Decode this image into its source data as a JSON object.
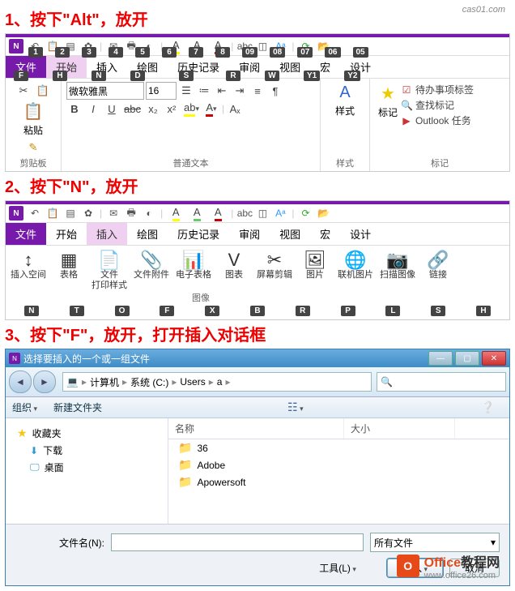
{
  "watermark": "cas01.com",
  "steps": {
    "s1": "1、按下\"Alt\"，放开",
    "s2": "2、按下\"N\"，放开",
    "s3": "3、按下\"F\"，放开，打开插入对话框"
  },
  "qat_keys": [
    "1",
    "2",
    "3",
    "4",
    "5",
    "6",
    "7",
    "8",
    "09",
    "08",
    "07",
    "06",
    "05"
  ],
  "tabs1": {
    "file": "文件",
    "home": "开始",
    "insert": "插入",
    "draw": "绘图",
    "history": "历史记录",
    "review": "审阅",
    "view": "视图",
    "macro": "宏",
    "design": "设计"
  },
  "tab1_keys": {
    "file": "F",
    "home": "H",
    "insert": "N",
    "draw": "D",
    "history": "S",
    "review": "R",
    "view": "W",
    "macro": "Y1",
    "design": "Y2"
  },
  "ribbon1": {
    "clipboard_lbl": "剪贴板",
    "paste": "粘贴",
    "font": "微软雅黑",
    "size": "16",
    "font_group_lbl": "普通文本",
    "style_btn": "样式",
    "style_group_lbl": "样式",
    "mark_btn": "标记",
    "mark_group_lbl": "标记",
    "todo": "待办事项标签",
    "findmark": "查找标记",
    "outlook": "Outlook 任务"
  },
  "tabs2": {
    "file": "文件",
    "home": "开始",
    "insert": "插入",
    "draw": "绘图",
    "history": "历史记录",
    "review": "审阅",
    "view": "视图",
    "macro": "宏",
    "design": "设计"
  },
  "ribbon2": {
    "items": [
      {
        "lbl": "插入空间",
        "key": "N"
      },
      {
        "lbl": "表格",
        "key": "T"
      },
      {
        "lbl": "文件\n打印样式",
        "key": "O"
      },
      {
        "lbl": "文件附件",
        "key": "F"
      },
      {
        "lbl": "电子表格",
        "key": "X"
      },
      {
        "lbl": "图表",
        "key": "B"
      },
      {
        "lbl": "屏幕剪辑",
        "key": "R"
      },
      {
        "lbl": "图片",
        "key": "P"
      },
      {
        "lbl": "联机图片",
        "key": "L"
      },
      {
        "lbl": "扫描图像",
        "key": "S"
      },
      {
        "lbl": "链接",
        "key": "H"
      }
    ],
    "img_group": "图像"
  },
  "dialog": {
    "title": "选择要插入的一个或一组文件",
    "path": {
      "p1": "计算机",
      "p2": "系统 (C:)",
      "p3": "Users",
      "p4": "a"
    },
    "organize": "组织",
    "newfolder": "新建文件夹",
    "fav": "收藏夹",
    "downloads": "下载",
    "desktop": "桌面",
    "col_name": "名称",
    "col_size": "大小",
    "files": [
      "36",
      "Adobe",
      "Apowersoft"
    ],
    "fname_lbl": "文件名(N):",
    "filter": "所有文件",
    "tools": "工具(L)",
    "open": "插入",
    "cancel": "取消"
  },
  "officewm": {
    "brand": "Office",
    "suffix": "教程网",
    "url": "www.office26.com",
    "icon": "O"
  }
}
